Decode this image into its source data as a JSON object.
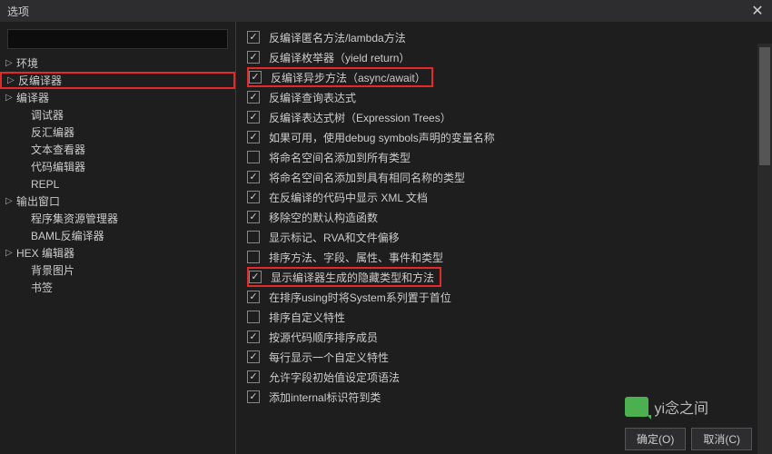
{
  "title": "选项",
  "sidebar": {
    "items": [
      {
        "label": "环境",
        "caret": true,
        "indent": false
      },
      {
        "label": "反编译器",
        "caret": true,
        "indent": false,
        "highlight": true
      },
      {
        "label": "编译器",
        "caret": true,
        "indent": false
      },
      {
        "label": "调试器",
        "caret": false,
        "indent": true
      },
      {
        "label": "反汇编器",
        "caret": false,
        "indent": true
      },
      {
        "label": "文本查看器",
        "caret": false,
        "indent": true
      },
      {
        "label": "代码编辑器",
        "caret": false,
        "indent": true
      },
      {
        "label": "REPL",
        "caret": false,
        "indent": true
      },
      {
        "label": "输出窗口",
        "caret": true,
        "indent": false
      },
      {
        "label": "程序集资源管理器",
        "caret": false,
        "indent": true
      },
      {
        "label": "BAML反编译器",
        "caret": false,
        "indent": true
      },
      {
        "label": "HEX 编辑器",
        "caret": true,
        "indent": false
      },
      {
        "label": "背景图片",
        "caret": false,
        "indent": true
      },
      {
        "label": "书签",
        "caret": false,
        "indent": true
      }
    ]
  },
  "options": [
    {
      "label": "反编译匿名方法/lambda方法",
      "checked": true
    },
    {
      "label": "反编译枚举器（yield return）",
      "checked": true
    },
    {
      "label": "反编译异步方法（async/await）",
      "checked": true,
      "highlight": true
    },
    {
      "label": "反编译查询表达式",
      "checked": true
    },
    {
      "label": "反编译表达式树（Expression Trees）",
      "checked": true
    },
    {
      "label": "如果可用，使用debug symbols声明的变量名称",
      "checked": true
    },
    {
      "label": "将命名空间名添加到所有类型",
      "checked": false
    },
    {
      "label": "将命名空间名添加到具有相同名称的类型",
      "checked": true
    },
    {
      "label": "在反编译的代码中显示 XML 文档",
      "checked": true
    },
    {
      "label": "移除空的默认构造函数",
      "checked": true
    },
    {
      "label": "显示标记、RVA和文件偏移",
      "checked": false
    },
    {
      "label": "排序方法、字段、属性、事件和类型",
      "checked": false
    },
    {
      "label": "显示编译器生成的隐藏类型和方法",
      "checked": true,
      "highlight": true
    },
    {
      "label": "在排序using时将System系列置于首位",
      "checked": true
    },
    {
      "label": "排序自定义特性",
      "checked": false
    },
    {
      "label": "按源代码顺序排序成员",
      "checked": true
    },
    {
      "label": "每行显示一个自定义特性",
      "checked": true
    },
    {
      "label": "允许字段初始值设定项语法",
      "checked": true
    },
    {
      "label": "添加internal标识符到类",
      "checked": true
    }
  ],
  "buttons": {
    "ok": "确定(O)",
    "cancel": "取消(C)"
  },
  "watermark": "yi念之间"
}
